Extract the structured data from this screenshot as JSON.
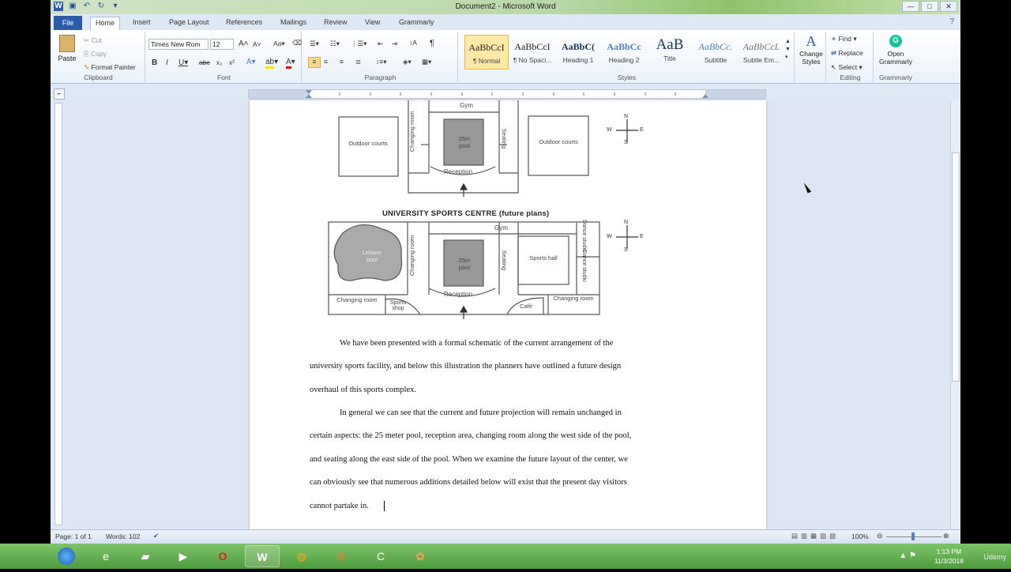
{
  "window": {
    "title": "Document2 - Microsoft Word",
    "controls": {
      "minimize": "—",
      "maximize": "□",
      "close": "✕"
    }
  },
  "tabs": [
    "File",
    "Home",
    "Insert",
    "Page Layout",
    "References",
    "Mailings",
    "Review",
    "View",
    "Grammarly"
  ],
  "clipboard": {
    "paste": "Paste",
    "cut": "Cut",
    "copy": "Copy",
    "format_painter": "Format Painter",
    "label": "Clipboard"
  },
  "font": {
    "name": "Times New Rom",
    "size": "12",
    "label": "Font"
  },
  "paragraph": {
    "label": "Paragraph"
  },
  "styles": {
    "label": "Styles",
    "items": [
      {
        "sample": "AaBbCcI",
        "name": "¶ Normal"
      },
      {
        "sample": "AaBbCcI",
        "name": "¶ No Spaci..."
      },
      {
        "sample": "AaBbC(",
        "name": "Heading 1"
      },
      {
        "sample": "AaBbCc",
        "name": "Heading 2"
      },
      {
        "sample": "AaB",
        "name": "Title"
      },
      {
        "sample": "AaBbCc.",
        "name": "Subtitle"
      },
      {
        "sample": "AaBbCcL",
        "name": "Subtle Em..."
      }
    ],
    "change_styles": "Change Styles"
  },
  "editing": {
    "find": "Find",
    "replace": "Replace",
    "select": "Select",
    "label": "Editing"
  },
  "grammarly": {
    "open": "Open Grammarly",
    "label": "Grammarly"
  },
  "diagram": {
    "top": {
      "labels": {
        "gym": "Gym",
        "changing": "Changing room",
        "pool": "25m pool",
        "seating": "Seating",
        "reception": "Reception",
        "outdoor_left": "Outdoor courts",
        "outdoor_right": "Outdoor courts"
      }
    },
    "title": "UNIVERSITY SPORTS CENTRE (future plans)",
    "future": {
      "labels": {
        "gym": "Gym",
        "leisure": "Leisure pool",
        "changing_v": "Changing room",
        "pool": "25m pool",
        "seating": "Seating",
        "sports_hall": "Sports hall",
        "dance1": "Dance studio",
        "dance2": "Dance studio",
        "changing_left": "Changing room",
        "sports_shop": "Sports shop",
        "reception": "Reception",
        "cafe": "Café",
        "changing_right": "Changing room"
      }
    },
    "compass": {
      "n": "N",
      "s": "S",
      "e": "E",
      "w": "W"
    }
  },
  "document": {
    "lines": [
      "We have been presented with a formal schematic of the current arrangement of the",
      "university sports facility, and below this illustration the planners have outlined a future design",
      "overhaul of this sports complex.",
      "In general we can see that the current and future projection will remain unchanged in",
      "certain aspects: the 25 meter pool, reception area, changing room along the west side of the pool,",
      "and seating along the east side of the pool. When we examine the future layout of the center, we",
      "can obviously see that numerous additions detailed below will exist that the present day visitors",
      "cannot partake in."
    ]
  },
  "status": {
    "page": "Page: 1 of 1",
    "words": "Words: 102",
    "zoom": "100%"
  },
  "taskbar": {
    "time": "1:13 PM",
    "date": "11/3/2018",
    "brand": "Udemy"
  }
}
